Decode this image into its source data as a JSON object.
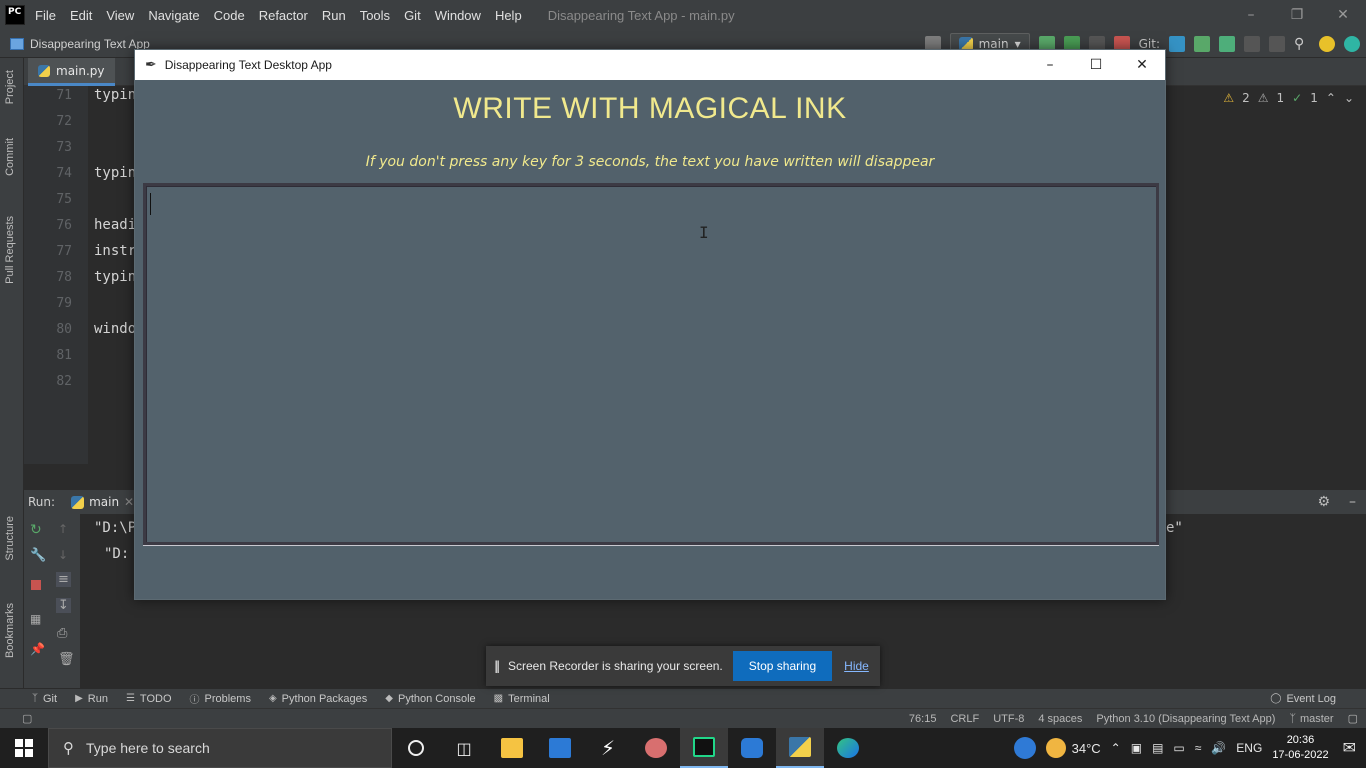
{
  "ide": {
    "logo": "PC",
    "menu": [
      "File",
      "Edit",
      "View",
      "Navigate",
      "Code",
      "Refactor",
      "Run",
      "Tools",
      "Git",
      "Window",
      "Help"
    ],
    "title": "Disappearing Text App - main.py",
    "project_name": "Disappearing Text App",
    "run_config": "main",
    "git_label": "Git:",
    "editor_tab": "main.py",
    "inspections": {
      "warnings": "2",
      "weak_warnings": "1",
      "typos": "1"
    },
    "line_numbers": [
      "71",
      "72",
      "73",
      "74",
      "75",
      "76",
      "77",
      "78",
      "79",
      "80",
      "81",
      "82"
    ],
    "code_lines": {
      "l71": "typin",
      "l74": "typin",
      "l76": "headi",
      "l77": "instr",
      "l78": "typin",
      "l80": "windo"
    },
    "run_panel": {
      "label": "Run:",
      "tab": "main",
      "output_line1": "\"D:\\P",
      "output_line2": "\"D:",
      "output_tail": "e\""
    },
    "left_strip": [
      "Project",
      "Commit",
      "Pull Requests",
      "Structure",
      "Bookmarks"
    ],
    "bottom_tools": [
      "Git",
      "Run",
      "TODO",
      "Problems",
      "Python Packages",
      "Python Console",
      "Terminal"
    ],
    "event_log": "Event Log",
    "status": {
      "position": "76:15",
      "line_sep": "CRLF",
      "encoding": "UTF-8",
      "indent": "4 spaces",
      "interpreter": "Python 3.10 (Disappearing Text App)",
      "branch": "master"
    }
  },
  "app": {
    "window_title": "Disappearing Text Desktop App",
    "heading": "WRITE WITH MAGICAL INK",
    "instructions": "If you don't press any key for 3 seconds, the text you have written will disappear",
    "typing_area_value": "",
    "colors": {
      "background": "#52616b",
      "text": "#f1e98d"
    }
  },
  "share_bar": {
    "message": "Screen Recorder is sharing your screen.",
    "stop_button": "Stop sharing",
    "hide_link": "Hide"
  },
  "taskbar": {
    "search_placeholder": "Type here to search",
    "weather": "34°C",
    "language": "ENG",
    "time": "20:36",
    "date": "17-06-2022"
  }
}
